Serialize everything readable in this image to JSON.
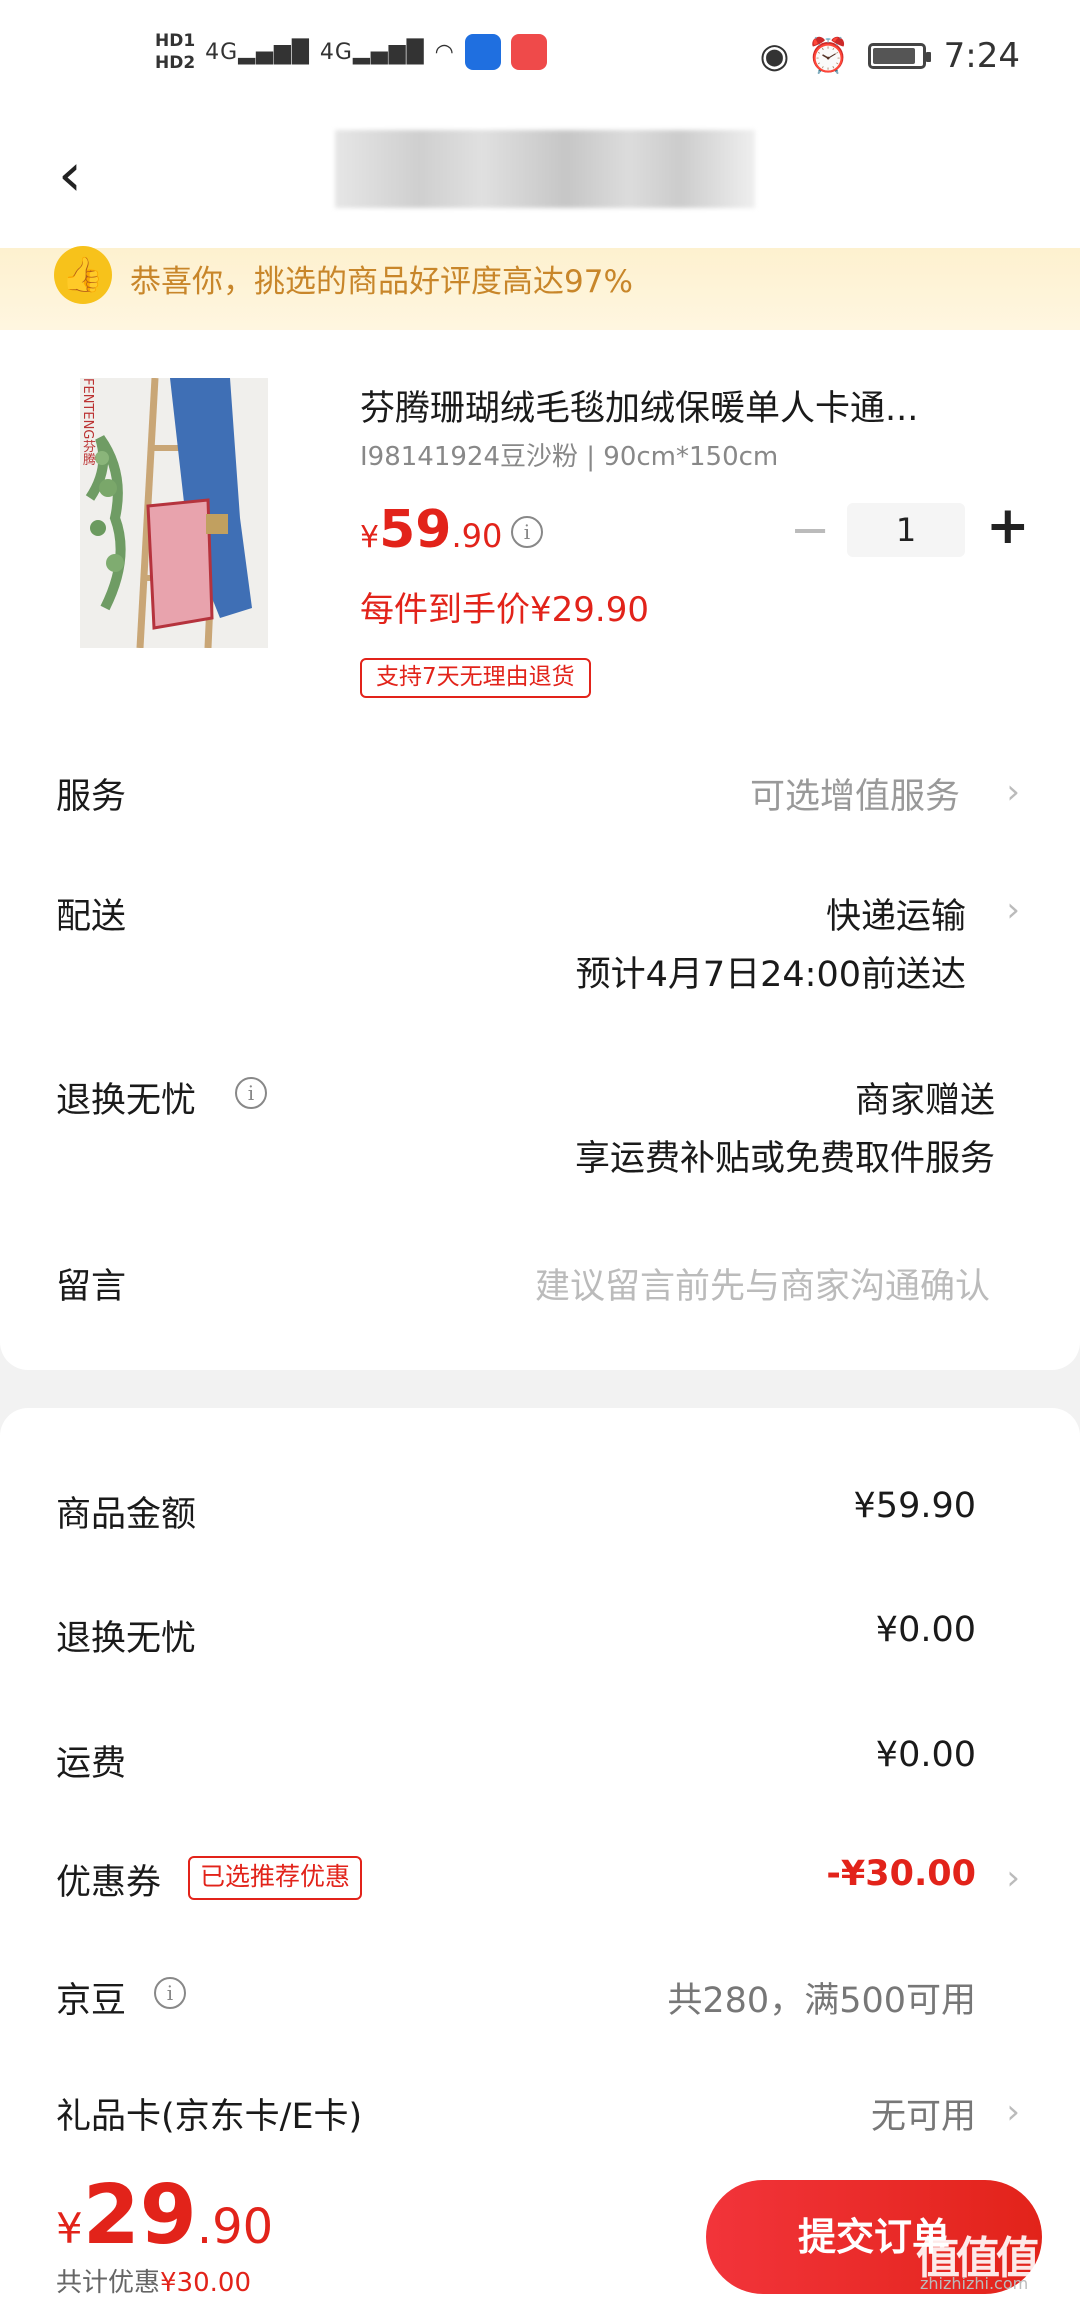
{
  "status_bar": {
    "hd1": "HD1",
    "hd2": "HD2",
    "signal1": "4G",
    "signal2": "4G",
    "time": "7:24"
  },
  "nav": {
    "back_icon": "chevron-left-icon"
  },
  "banner": {
    "text": "恭喜你，挑选的商品好评度高达97%",
    "icon": "thumbs-up-icon"
  },
  "product": {
    "title": "芬腾珊瑚绒毛毯加绒保暖单人卡通...",
    "spec": "I98141924豆沙粉 | 90cm*150cm",
    "price_symbol": "¥",
    "price_int": "59",
    "price_dec": ".90",
    "unit_price": "每件到手价¥29.90",
    "return_tag": "支持7天无理由退货",
    "quantity": "1",
    "brand_on_image": "FENTENG芬腾"
  },
  "rows": {
    "service": {
      "label": "服务",
      "value": "可选增值服务"
    },
    "delivery": {
      "label": "配送",
      "value": "快递运输",
      "sub": "预计4月7日24:00前送达"
    },
    "returns": {
      "label": "退换无忧",
      "value": "商家赠送",
      "sub": "享运费补贴或免费取件服务"
    },
    "message": {
      "label": "留言",
      "placeholder": "建议留言前先与商家沟通确认"
    }
  },
  "summary": {
    "goods": {
      "label": "商品金额",
      "value": "¥59.90"
    },
    "returns": {
      "label": "退换无忧",
      "value": "¥0.00"
    },
    "shipping": {
      "label": "运费",
      "value": "¥0.00"
    },
    "coupon": {
      "label": "优惠券",
      "tag": "已选推荐优惠",
      "value": "-¥30.00"
    },
    "jingdou": {
      "label": "京豆",
      "value": "共280，满500可用"
    },
    "giftcard": {
      "label": "礼品卡(京东卡/E卡)",
      "value": "无可用"
    }
  },
  "footer": {
    "total_symbol": "¥",
    "total_int": "29",
    "total_dec": ".90",
    "saved_label": "共计优惠",
    "saved_value": "¥30.00",
    "submit_label": "提交订单",
    "watermark": "值值值",
    "watermark_sub": "zhizhizhi.com"
  },
  "colors": {
    "accent": "#e2231a",
    "banner_text": "#c8862a",
    "banner_bg": "#fdf1cf"
  }
}
